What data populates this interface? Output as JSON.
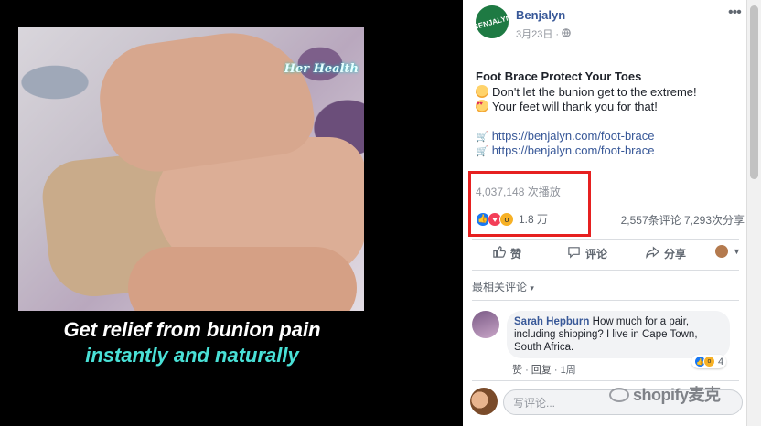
{
  "video": {
    "watermark": "Her Health",
    "caption_line1": "Get relief from bunion pain",
    "caption_line2": "instantly and naturally"
  },
  "post": {
    "page_name": "Benjalyn",
    "avatar_text": "BENJALYN",
    "date": "3月23日",
    "title": "Foot Brace Protect Your Toes",
    "line1": "Don't let the bunion get to the extreme!",
    "line2": "Your feet will thank you for that!",
    "link1": "https://benjalyn.com/foot-brace",
    "link2": "https://benjalyn.com/foot-brace",
    "views": "4,037,148 次播放",
    "reaction_count": "1.8 万",
    "comments_count": "2,557条评论",
    "shares_count": "7,293次分享",
    "more_label": "•••"
  },
  "actions": {
    "like": "赞",
    "comment": "评论",
    "share": "分享"
  },
  "comments": {
    "sort_label": "最相关评论",
    "items": [
      {
        "author": "Sarah Hepburn",
        "text": "How much for a pair, including shipping? I live in Cape Town, South Africa.",
        "like": "赞",
        "reply": "回复",
        "time": "1周",
        "reactions": "4"
      }
    ],
    "composer_placeholder": "写评论..."
  },
  "overlay_watermark": "shopify麦克",
  "colors": {
    "accent": "#385898",
    "highlight": "#e62020",
    "caption_cyan": "#49e0d6"
  }
}
